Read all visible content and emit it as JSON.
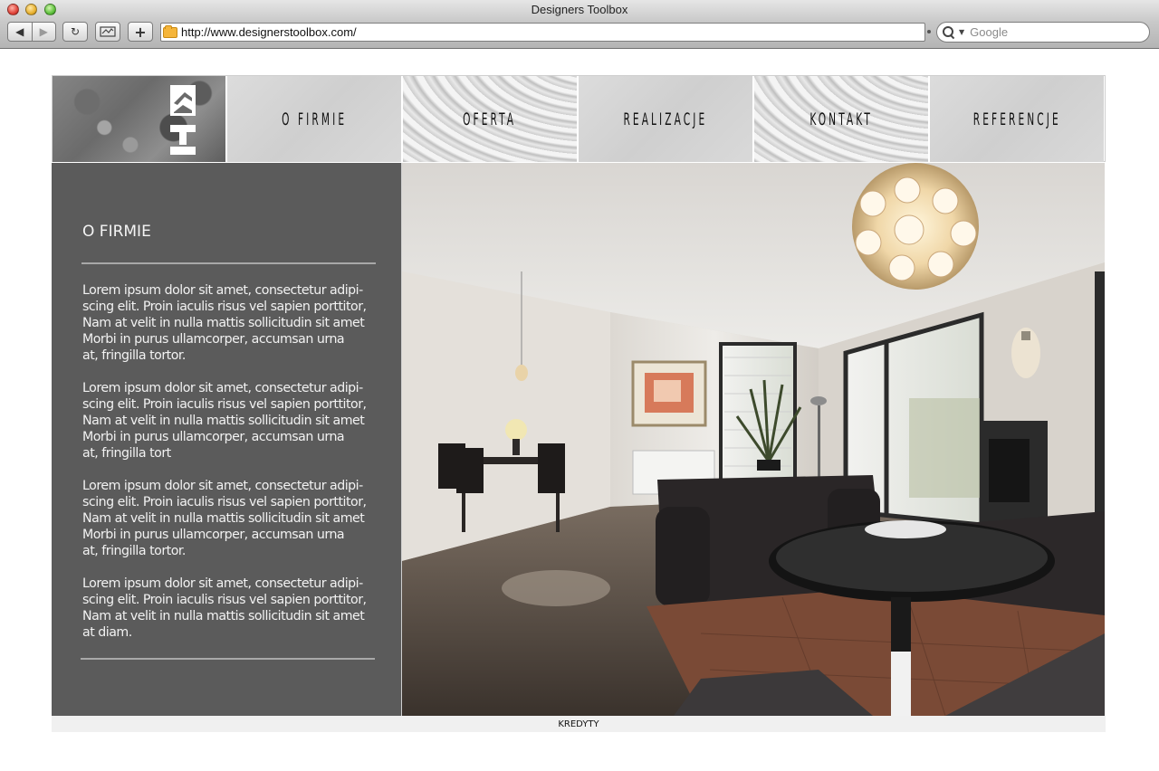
{
  "browser": {
    "window_title": "Designers Toolbox",
    "url": "http://www.designerstoolbox.com/",
    "search_placeholder": "Google"
  },
  "site": {
    "menu": [
      {
        "label": "O FIRMIE",
        "style": "plain"
      },
      {
        "label": "OFERTA",
        "style": "wave"
      },
      {
        "label": "REALIZACJE",
        "style": "plain"
      },
      {
        "label": "KONTAKT",
        "style": "wave"
      },
      {
        "label": "REFERENCJE",
        "style": "plain"
      }
    ],
    "section": {
      "title": "O FIRMIE",
      "paragraphs": [
        "Lorem ipsum dolor sit amet, consectetur adipi-\nscing elit. Proin iaculis risus vel sapien porttitor,\nNam at velit in nulla mattis sollicitudin sit amet\nMorbi in purus ullamcorper, accumsan urna\nat, fringilla tortor.",
        "Lorem ipsum dolor sit amet, consectetur adipi-\nscing elit. Proin iaculis risus vel sapien porttitor,\nNam at velit in nulla mattis sollicitudin sit amet\nMorbi in purus ullamcorper, accumsan urna\nat, fringilla tort",
        "Lorem ipsum dolor sit amet, consectetur adipi-\nscing elit. Proin iaculis risus vel sapien porttitor,\nNam at velit in nulla mattis sollicitudin sit amet\nMorbi in purus ullamcorper, accumsan urna\nat, fringilla tortor.",
        "Lorem ipsum dolor sit amet, consectetur adipi-\nscing elit. Proin iaculis risus vel sapien porttitor,\nNam at velit in nulla mattis sollicitudin sit amet\nat diam."
      ]
    },
    "footer": "KREDYTY"
  }
}
